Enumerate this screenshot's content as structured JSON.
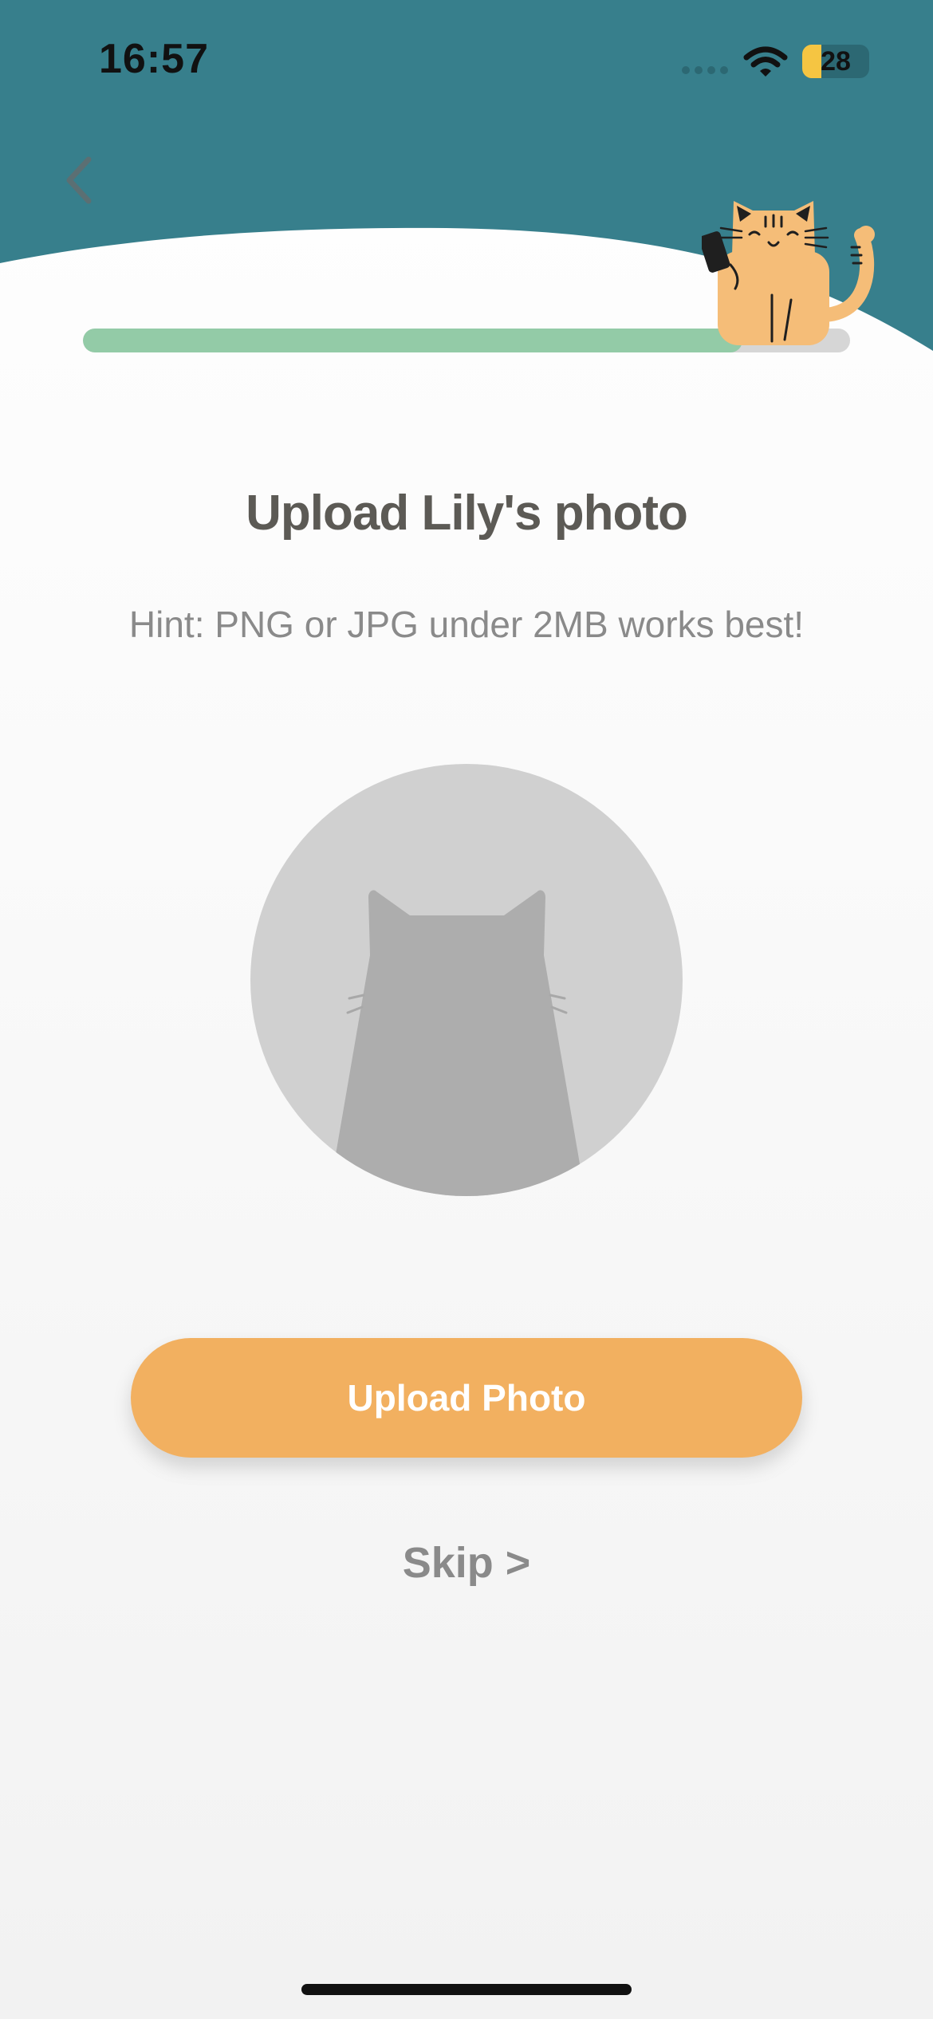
{
  "status_bar": {
    "time": "16:57",
    "battery_level": "28",
    "icons": [
      "cellular-signal-icon",
      "wifi-icon",
      "battery-icon"
    ]
  },
  "colors": {
    "header": "#377f8c",
    "progress_fill": "#93cba7",
    "progress_track": "#d6d6d6",
    "primary_button": "#f2b060",
    "title_text": "#5c5a55",
    "muted_text": "#8a8a8a",
    "placeholder_circle": "#d0d0d0",
    "placeholder_silhouette": "#adadad",
    "mascot": "#f5bd78"
  },
  "header": {
    "back_icon": "chevron-left-icon",
    "mascot": "cat-holding-phone-illustration"
  },
  "progress": {
    "value_fraction": 0.86
  },
  "main": {
    "title": "Upload Lily's photo",
    "hint": "Hint: PNG or JPG under 2MB works best!",
    "placeholder_icon": "cat-silhouette-icon",
    "upload_button_label": "Upload Photo",
    "skip_label": "Skip >"
  }
}
